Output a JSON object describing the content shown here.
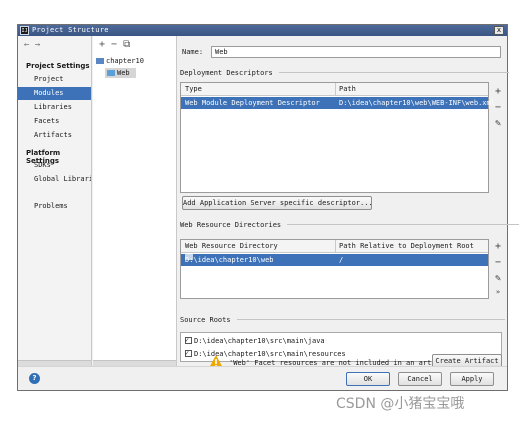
{
  "window": {
    "title": "Project Structure",
    "app_icon_text": "IJ",
    "close_glyph": "x"
  },
  "nav": {
    "arrows": "← →",
    "group1": "Project Settings",
    "items1": [
      "Project",
      "Modules",
      "Libraries",
      "Facets",
      "Artifacts"
    ],
    "group2": "Platform Settings",
    "items2": [
      "SDKs",
      "Global Libraries"
    ],
    "problems": "Problems",
    "selected": "Modules"
  },
  "tree": {
    "toolbar": "+ − ⧉",
    "root": "chapter10",
    "child": "Web"
  },
  "name": {
    "label": "Name:",
    "value": "Web"
  },
  "deployment": {
    "section": "Deployment Descriptors",
    "col_type": "Type",
    "col_path": "Path",
    "row_type": "Web Module Deployment Descriptor",
    "row_path": "D:\\idea\\chapter10\\web\\WEB-INF\\web.xml",
    "add_button": "Add Application Server specific descriptor..."
  },
  "resources": {
    "section": "Web Resource Directories",
    "col_dir": "Web Resource Directory",
    "col_rel": "Path Relative to Deployment Root",
    "row_dir": "D:\\idea\\chapter10\\web",
    "row_rel": "/"
  },
  "side_buttons": {
    "add": "+",
    "remove": "−",
    "edit": "✎",
    "more": "»"
  },
  "source_roots": {
    "section": "Source Roots",
    "items": [
      "D:\\idea\\chapter10\\src\\main\\java",
      "D:\\idea\\chapter10\\src\\main\\resources"
    ]
  },
  "warning": {
    "text": "'Web' Facet resources are not included in an artifact",
    "button": "Create Artifact"
  },
  "footer": {
    "help": "?",
    "ok": "OK",
    "cancel": "Cancel",
    "apply": "Apply"
  },
  "watermark": "CSDN @小猪宝宝哦",
  "colors": {
    "selection": "#3d72b8",
    "titlebar": "#3a5584",
    "warning": "#f0a800"
  }
}
